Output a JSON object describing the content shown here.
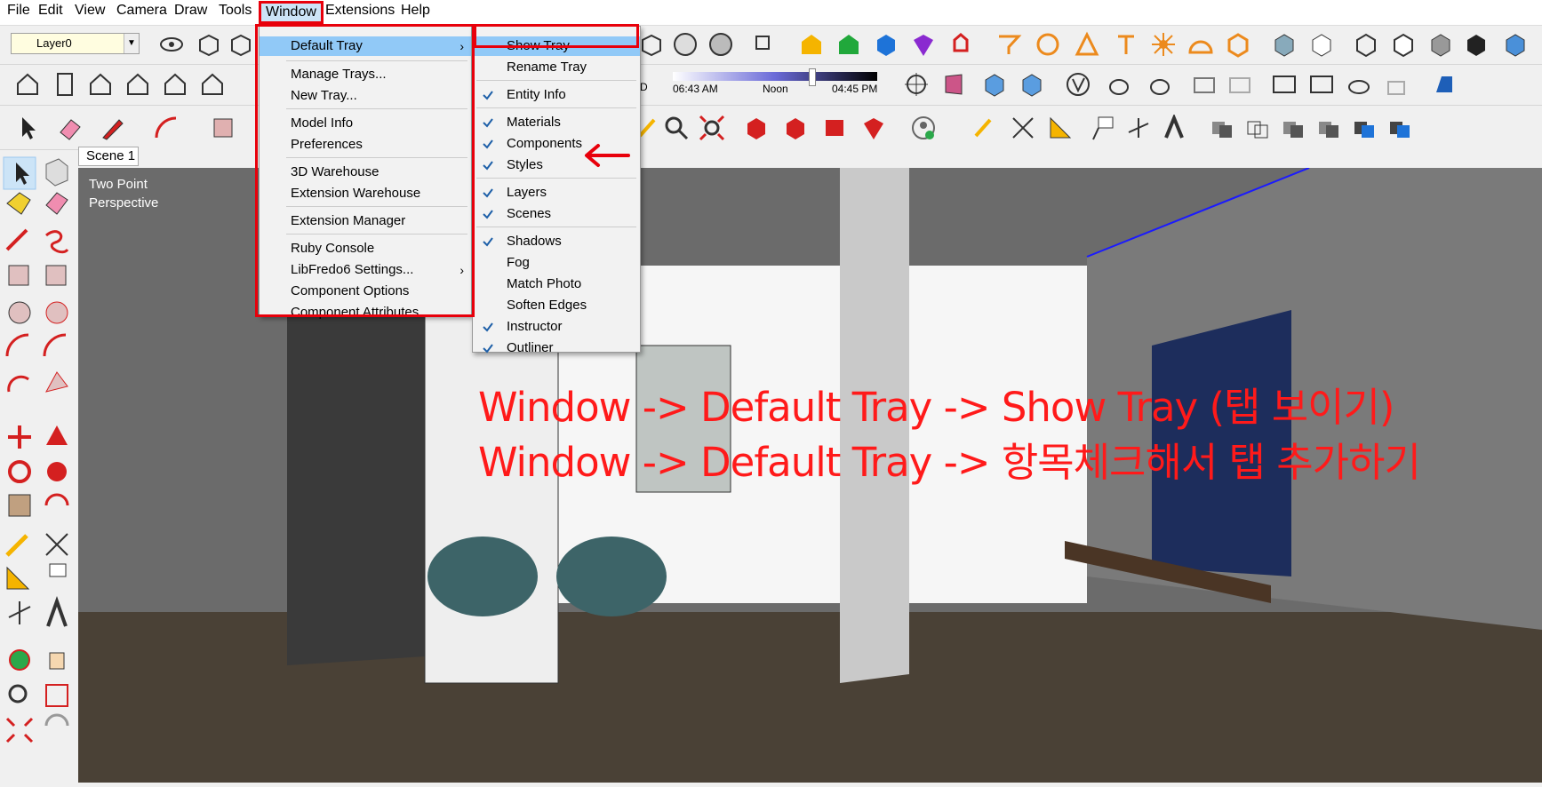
{
  "menubar": {
    "items": [
      "File",
      "Edit",
      "View",
      "Camera",
      "Draw",
      "Tools",
      "Window",
      "Extensions",
      "Help"
    ],
    "active": "Window"
  },
  "layer_select": {
    "value": "Layer0"
  },
  "shadow_slider": {
    "time_start": "06:43 AM",
    "time_mid": "Noon",
    "time_end": "04:45 PM",
    "date_fragment": "D"
  },
  "scene_tab": {
    "label": "Scene 1"
  },
  "viewport": {
    "label_line1": "Two Point",
    "label_line2": "Perspective"
  },
  "window_menu": {
    "items": [
      {
        "label": "Default Tray",
        "submenu": true,
        "selected": true
      },
      {
        "label": "Manage Trays..."
      },
      {
        "label": "New Tray..."
      },
      {
        "label": "Model Info"
      },
      {
        "label": "Preferences"
      },
      {
        "label": "3D Warehouse"
      },
      {
        "label": "Extension Warehouse"
      },
      {
        "label": "Extension Manager"
      },
      {
        "label": "Ruby Console"
      },
      {
        "label": "LibFredo6 Settings...",
        "submenu": true
      },
      {
        "label": "Component Options"
      },
      {
        "label": "Component Attributes"
      }
    ],
    "submenu_arrow": "›"
  },
  "tray_menu": {
    "items": [
      {
        "label": "Show Tray",
        "checked": false,
        "selected": true
      },
      {
        "label": "Rename Tray",
        "checked": false
      },
      {
        "label": "Entity Info",
        "checked": true
      },
      {
        "label": "Materials",
        "checked": true
      },
      {
        "label": "Components",
        "checked": true
      },
      {
        "label": "Styles",
        "checked": true
      },
      {
        "label": "Layers",
        "checked": true
      },
      {
        "label": "Scenes",
        "checked": true
      },
      {
        "label": "Shadows",
        "checked": true
      },
      {
        "label": "Fog",
        "checked": false
      },
      {
        "label": "Match Photo",
        "checked": false
      },
      {
        "label": "Soften Edges",
        "checked": false
      },
      {
        "label": "Instructor",
        "checked": true
      },
      {
        "label": "Outliner",
        "checked": true
      }
    ]
  },
  "annotation": {
    "line1": "Window -> Default Tray -> Show Tray (탭 보이기)",
    "line2": "Window -> Default Tray -> 항목체크해서 탭 추가하기",
    "color": "#ff1a1a"
  },
  "colors": {
    "highlight": "#e8000b",
    "selection": "#91c9f7"
  }
}
